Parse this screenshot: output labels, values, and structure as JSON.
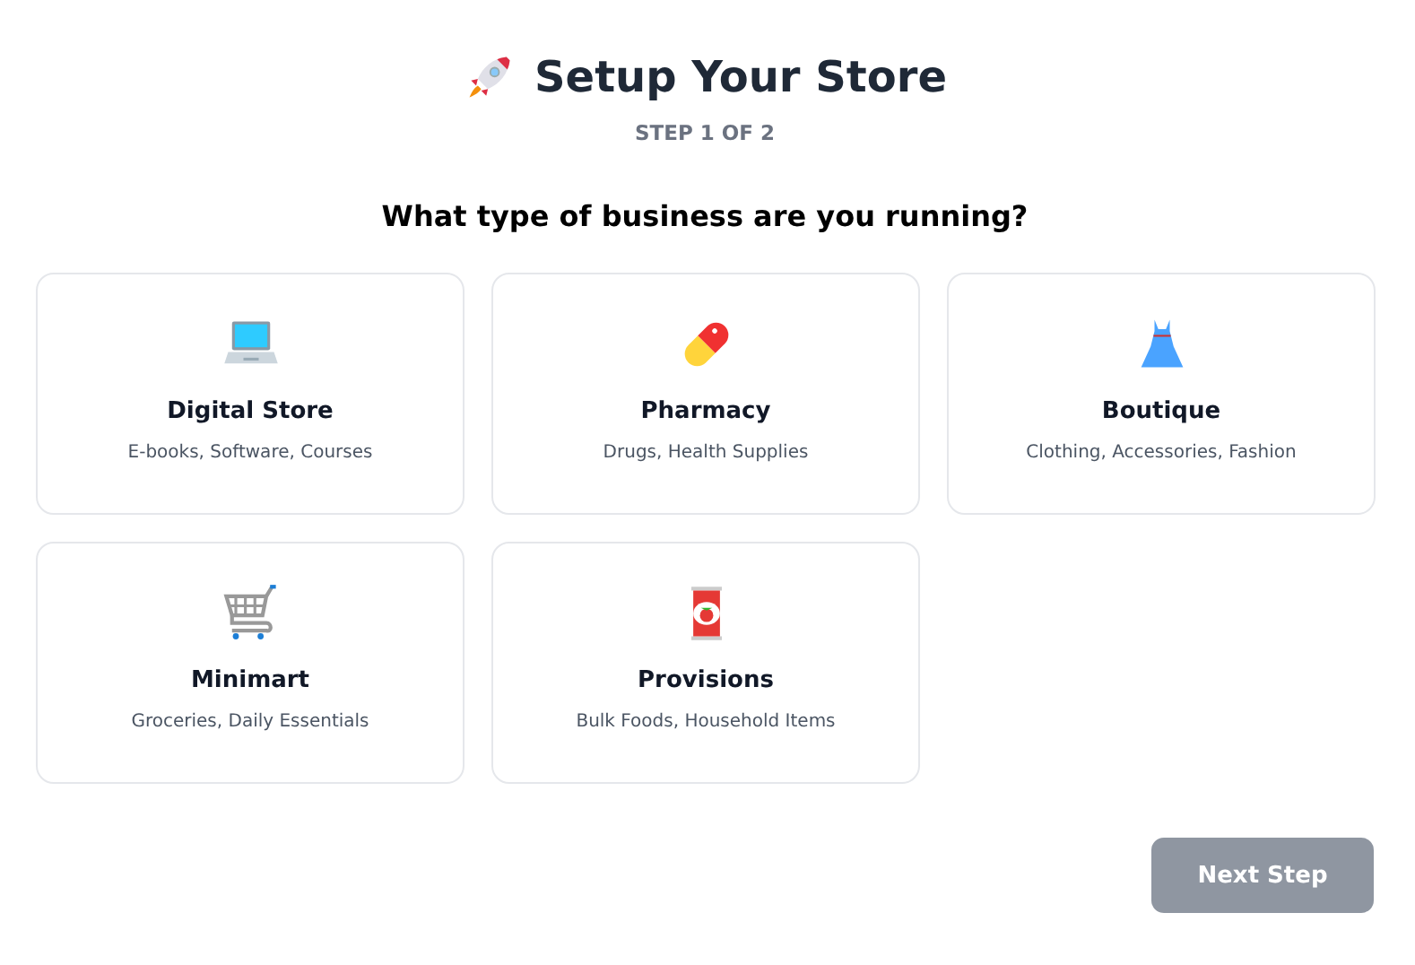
{
  "header": {
    "title": "Setup Your Store",
    "step": "STEP 1 OF 2"
  },
  "question": "What type of business are you running?",
  "business_types": [
    {
      "name": "Digital Store",
      "description": "E-books, Software, Courses"
    },
    {
      "name": "Pharmacy",
      "description": "Drugs, Health Supplies"
    },
    {
      "name": "Boutique",
      "description": "Clothing, Accessories, Fashion"
    },
    {
      "name": "Minimart",
      "description": "Groceries, Daily Essentials"
    },
    {
      "name": "Provisions",
      "description": "Bulk Foods, Household Items"
    }
  ],
  "next_button": {
    "label": "Next Step",
    "disabled": true
  }
}
